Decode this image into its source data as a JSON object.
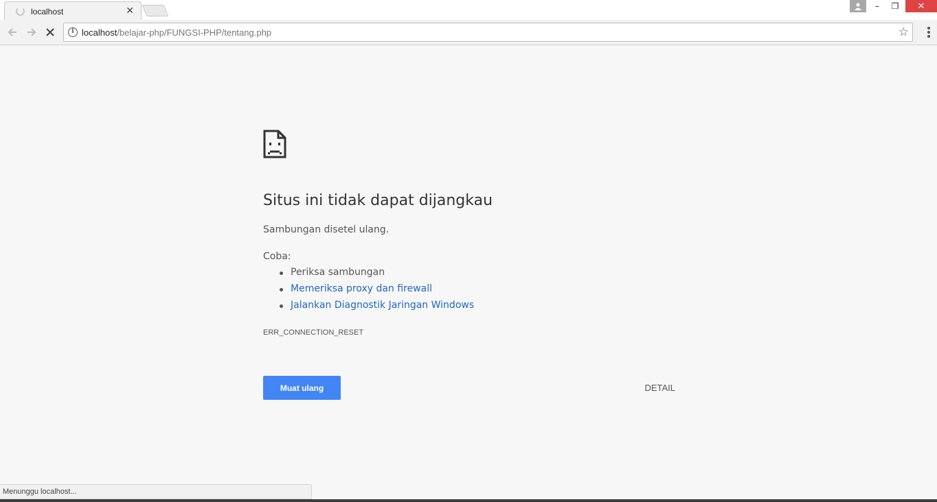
{
  "browser": {
    "tab_title": "localhost",
    "tab_close_icon": "close-icon",
    "url_host": "localhost",
    "url_path": "/belajar-php/FUNGSI-PHP/tentang.php",
    "info_icon": "info-icon",
    "info_glyph": "i",
    "window_controls": {
      "minimize": "–",
      "maximize": "❐",
      "close": "✕"
    }
  },
  "error_page": {
    "title": "Situs ini tidak dapat dijangkau",
    "message": "Sambungan disetel ulang.",
    "suggestions_heading": "Coba:",
    "suggestions": [
      "Periksa sambungan",
      "Memeriksa proxy dan firewall",
      "Jalankan Diagnostik Jaringan Windows"
    ],
    "error_code": "ERR_CONNECTION_RESET",
    "reload_button": "Muat ulang",
    "details_button": "DETAIL"
  },
  "status_bar": {
    "text": "Menunggu localhost..."
  },
  "colors": {
    "accent": "#4285f4",
    "link": "#1f66c2",
    "close_button": "#e04343",
    "page_background": "#f7f7f7"
  }
}
